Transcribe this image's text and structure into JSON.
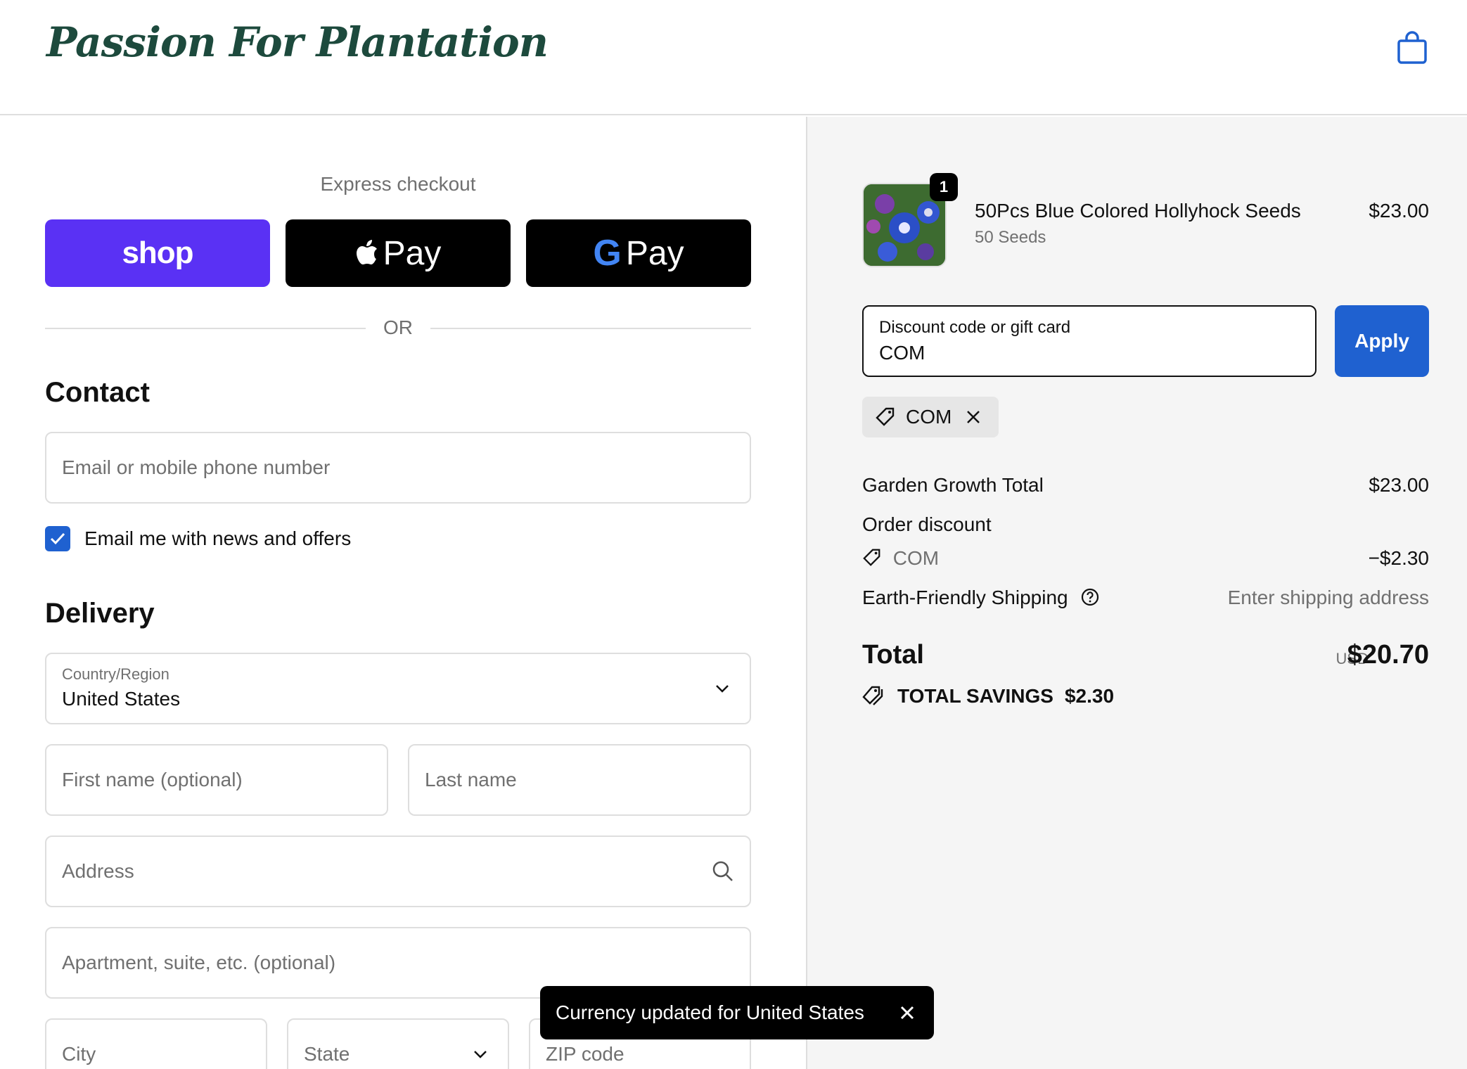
{
  "header": {
    "logo_text": "Passion For Plantation",
    "cart_icon": "shopping-bag-icon"
  },
  "express": {
    "title": "Express checkout",
    "shop_label": "shop",
    "apple_label": "Pay",
    "google_label": "Pay",
    "or_label": "OR"
  },
  "contact": {
    "title": "Contact",
    "email_placeholder": "Email or mobile phone number",
    "newsletter_label": "Email me with news and offers",
    "newsletter_checked": true
  },
  "delivery": {
    "title": "Delivery",
    "country_label": "Country/Region",
    "country_value": "United States",
    "first_name_placeholder": "First name (optional)",
    "last_name_placeholder": "Last name",
    "address_placeholder": "Address",
    "apartment_placeholder": "Apartment, suite, etc. (optional)",
    "city_placeholder": "City",
    "state_placeholder": "State",
    "zip_placeholder": "ZIP code"
  },
  "toast": {
    "message": "Currency updated for United States"
  },
  "order": {
    "item": {
      "quantity": "1",
      "title": "50Pcs Blue Colored Hollyhock Seeds",
      "variant": "50 Seeds",
      "price": "$23.00"
    },
    "discount_label": "Discount code or gift card",
    "discount_value": "COM",
    "apply_label": "Apply",
    "applied_code": "COM",
    "subtotal_label": "Garden Growth Total",
    "subtotal_value": "$23.00",
    "order_discount_label": "Order discount",
    "order_discount_code": "COM",
    "order_discount_value": "−$2.30",
    "shipping_label": "Earth-Friendly Shipping",
    "shipping_value": "Enter shipping address",
    "total_label": "Total",
    "total_currency": "USD",
    "total_value": "$20.70",
    "savings_label": "TOTAL SAVINGS",
    "savings_value": "$2.30"
  },
  "colors": {
    "accent": "#1f61d0",
    "shop_pay": "#5a31f4",
    "logo": "#1d4a3d"
  }
}
